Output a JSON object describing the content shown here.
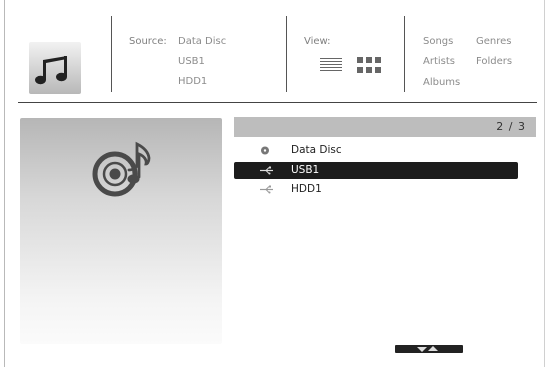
{
  "header": {
    "app_icon": "music-notes-icon",
    "source": {
      "label": "Source:",
      "items": [
        "Data Disc",
        "USB1",
        "HDD1"
      ]
    },
    "view": {
      "label": "View:",
      "options": [
        "list-view-icon",
        "grid-view-icon"
      ]
    },
    "categories": {
      "col1": [
        "Songs",
        "Artists",
        "Albums"
      ],
      "col2": [
        "Genres",
        "Folders"
      ]
    }
  },
  "preview": {
    "icon": "disc-music-icon"
  },
  "list": {
    "page_indicator": "2 / 3",
    "items": [
      {
        "label": "Data Disc",
        "icon": "disc-icon",
        "selected": false
      },
      {
        "label": "USB1",
        "icon": "usb-icon",
        "selected": true
      },
      {
        "label": "HDD1",
        "icon": "usb-icon",
        "selected": false
      }
    ]
  },
  "scroll": {
    "icon": "scroll-arrows-icon"
  },
  "colors": {
    "selection": "#1c1c1c",
    "list_header": "#bdbdbd",
    "separator": "#444444"
  }
}
